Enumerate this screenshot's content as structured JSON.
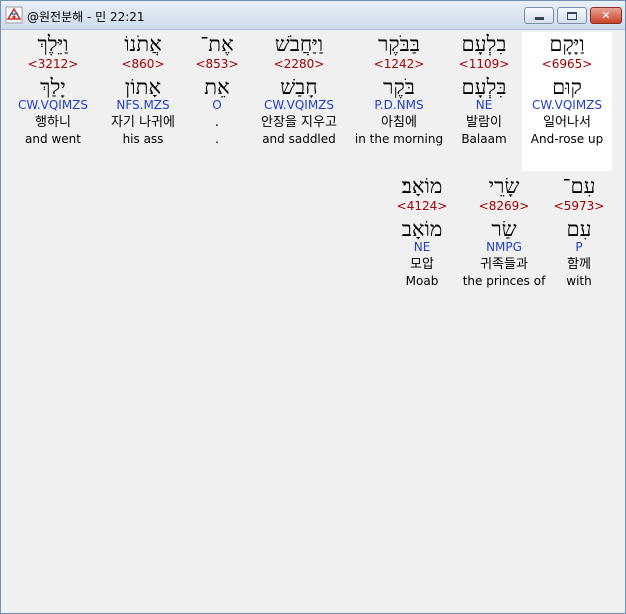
{
  "window": {
    "title": "@원전분해 - 민 22:21",
    "close_glyph": "✕"
  },
  "colors": {
    "strong_number": "#a00000",
    "parsing_code": "#1f3fc7",
    "highlight": "#ffffff"
  },
  "rows": [
    {
      "words": [
        {
          "hebrew": "וַיָּקָם",
          "strong": "<6965>",
          "lemma": "קוּם",
          "parsing": "CW.VQIMZS",
          "korean": "일어나서",
          "english": "And-rose up",
          "highlighted": true
        },
        {
          "hebrew": "בִלְעָם",
          "strong": "<1109>",
          "lemma": "בִּלְעָם",
          "parsing": "NE",
          "korean": "발람이",
          "english": "Balaam",
          "highlighted": false
        },
        {
          "hebrew": "בַּבֹּקֶר",
          "strong": "<1242>",
          "lemma": "בֹּקֶר",
          "parsing": "P.D.NMS",
          "korean": "아침에",
          "english": "in the morning",
          "highlighted": false
        },
        {
          "hebrew": "וַיַּחֲבֹשׁ",
          "strong": "<2280>",
          "lemma": "חָבַשׁ",
          "parsing": "CW.VQIMZS",
          "korean": "안장을 지우고",
          "english": "and saddled",
          "highlighted": false
        },
        {
          "hebrew": "אֶת־",
          "strong": "<853>",
          "lemma": "אֵת",
          "parsing": "O",
          "korean": ".",
          "english": ".",
          "highlighted": false
        },
        {
          "hebrew": "אֲתֹנוֹ",
          "strong": "<860>",
          "lemma": "אָתוֹן",
          "parsing": "NFS.MZS",
          "korean": "자기 나귀에",
          "english": "his ass",
          "highlighted": false
        },
        {
          "hebrew": "וַיֵּלֶךְ",
          "strong": "<3212>",
          "lemma": "יָלַךְ",
          "parsing": "CW.VQIMZS",
          "korean": "행하니",
          "english": "and went",
          "highlighted": false
        }
      ]
    },
    {
      "words": [
        {
          "hebrew": "עִם־",
          "strong": "<5973>",
          "lemma": "עִם",
          "parsing": "P",
          "korean": "함께",
          "english": "with",
          "highlighted": false
        },
        {
          "hebrew": "שָׂרֵי",
          "strong": "<8269>",
          "lemma": "שַׂר",
          "parsing": "NMPG",
          "korean": "귀족들과",
          "english": "the princes of",
          "highlighted": false
        },
        {
          "hebrew": "מוֹאָב׃",
          "strong": "<4124>",
          "lemma": "מוֹאָב",
          "parsing": "NE",
          "korean": "모압",
          "english": "Moab",
          "highlighted": false
        }
      ]
    }
  ]
}
